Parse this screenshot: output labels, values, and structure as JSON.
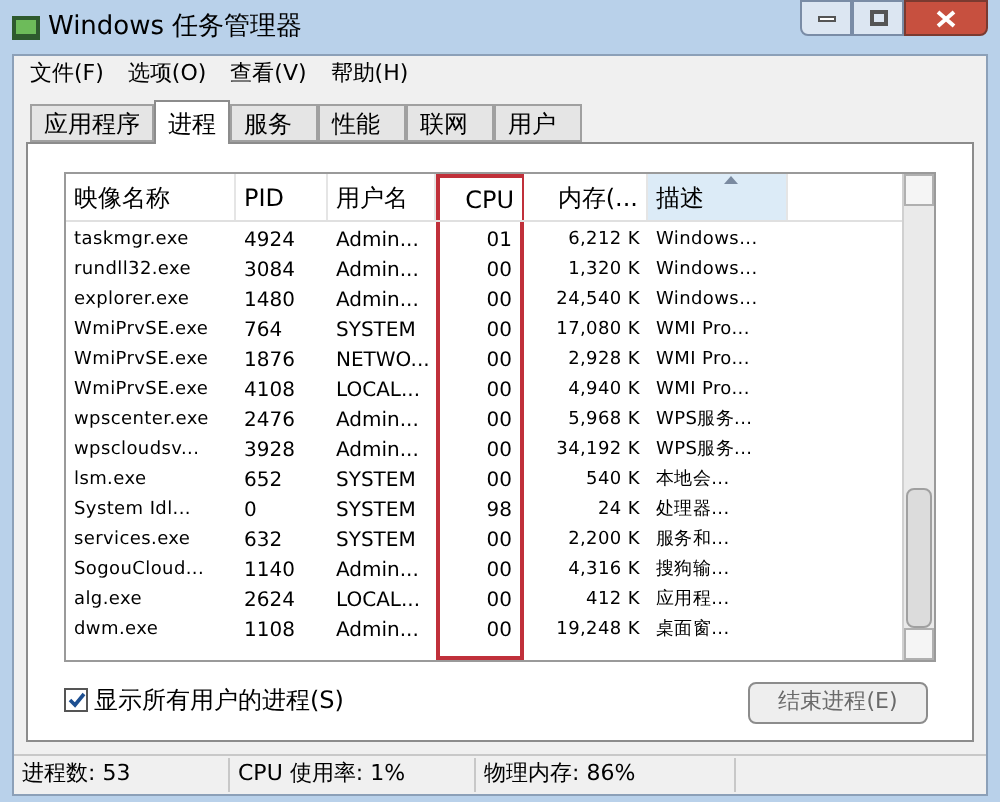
{
  "window": {
    "title": "Windows 任务管理器"
  },
  "menu": [
    "文件(F)",
    "选项(O)",
    "查看(V)",
    "帮助(H)"
  ],
  "tabs": [
    {
      "label": "应用程序",
      "selected": false
    },
    {
      "label": "进程",
      "selected": true
    },
    {
      "label": "服务",
      "selected": false
    },
    {
      "label": "性能",
      "selected": false
    },
    {
      "label": "联网",
      "selected": false
    },
    {
      "label": "用户",
      "selected": false
    }
  ],
  "table": {
    "columns": [
      {
        "label": "映像名称",
        "highlighted": false,
        "sorted": false
      },
      {
        "label": "PID",
        "highlighted": false,
        "sorted": false
      },
      {
        "label": "用户名",
        "highlighted": false,
        "sorted": false
      },
      {
        "label": "CPU",
        "highlighted": true,
        "sorted": false
      },
      {
        "label": "内存(...",
        "highlighted": false,
        "sorted": false
      },
      {
        "label": "描述",
        "highlighted": false,
        "sorted": true
      }
    ],
    "rows": [
      [
        "taskmgr.exe",
        "4924",
        "Admin...",
        "01",
        "6,212 K",
        "Windows..."
      ],
      [
        "rundll32.exe",
        "3084",
        "Admin...",
        "00",
        "1,320 K",
        "Windows..."
      ],
      [
        "explorer.exe",
        "1480",
        "Admin...",
        "00",
        "24,540 K",
        "Windows..."
      ],
      [
        "WmiPrvSE.exe",
        "764",
        "SYSTEM",
        "00",
        "17,080 K",
        "WMI Pro..."
      ],
      [
        "WmiPrvSE.exe",
        "1876",
        "NETWO...",
        "00",
        "2,928 K",
        "WMI Pro..."
      ],
      [
        "WmiPrvSE.exe",
        "4108",
        "LOCAL...",
        "00",
        "4,940 K",
        "WMI Pro..."
      ],
      [
        "wpscenter.exe",
        "2476",
        "Admin...",
        "00",
        "5,968 K",
        "WPS服务..."
      ],
      [
        "wpscloudsv...",
        "3928",
        "Admin...",
        "00",
        "34,192 K",
        "WPS服务..."
      ],
      [
        "lsm.exe",
        "652",
        "SYSTEM",
        "00",
        "540 K",
        "本地会..."
      ],
      [
        "System Idl...",
        "0",
        "SYSTEM",
        "98",
        "24 K",
        "处理器..."
      ],
      [
        "services.exe",
        "632",
        "SYSTEM",
        "00",
        "2,200 K",
        "服务和..."
      ],
      [
        "SogouCloud...",
        "1140",
        "Admin...",
        "00",
        "4,316 K",
        "搜狗输..."
      ],
      [
        "alg.exe",
        "2624",
        "LOCAL...",
        "00",
        "412 K",
        "应用程..."
      ],
      [
        "dwm.exe",
        "1108",
        "Admin...",
        "00",
        "19,248 K",
        "桌面窗..."
      ]
    ]
  },
  "show_all_users": {
    "label": "显示所有用户的进程(S)",
    "checked": true
  },
  "end_process_button": "结束进程(E)",
  "status_bar": [
    "进程数: 53",
    "CPU 使用率: 1%",
    "物理内存: 86%"
  ]
}
